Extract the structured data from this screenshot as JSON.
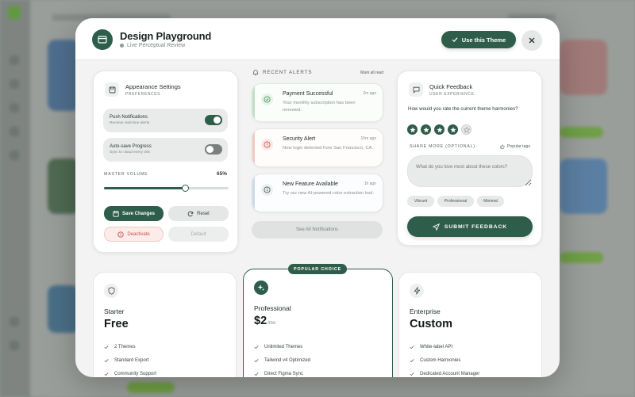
{
  "header": {
    "title": "Design Playground",
    "subtitle": "Live Perceptual Review",
    "use_theme": "Use this Theme"
  },
  "appearance": {
    "title": "Appearance Settings",
    "tag": "PREFERENCES",
    "push": {
      "title": "Push Notifications",
      "sub": "Receive real-time alerts",
      "on": true
    },
    "autosave": {
      "title": "Auto-save Progress",
      "sub": "Sync to cloud every 30s",
      "on": false
    },
    "volume_label": "MASTER VOLUME",
    "volume_value": "65%",
    "volume": 0.65,
    "save": "Save Changes",
    "reset": "Reset",
    "deactivate": "Deactivate",
    "default": "Default"
  },
  "alerts": {
    "title": "RECENT ALERTS",
    "mark_all": "Mark all read",
    "items": [
      {
        "title": "Payment Successful",
        "time": "2m ago",
        "msg": "Your monthly subscription has been renewed.",
        "color": "#4f9a5e"
      },
      {
        "title": "Security Alert",
        "time": "15m ago",
        "msg": "New login detected from San Francisco, CA.",
        "color": "#d9534f"
      },
      {
        "title": "New Feature Available",
        "time": "1h ago",
        "msg": "Try our new AI-powered color extraction tool.",
        "color": "#5b7fa8"
      }
    ],
    "see_all": "See All Notifications"
  },
  "feedback": {
    "title": "Quick Feedback",
    "tag": "USER EXPERIENCE",
    "question": "How would you rate the current theme harmonies?",
    "rating": 4,
    "max_rating": 5,
    "share_label": "SHARE MORE (OPTIONAL)",
    "popular_tags": "Popular tags",
    "placeholder": "What do you love most about these colors?",
    "chips": [
      "Vibrant",
      "Professional",
      "Minimal"
    ],
    "submit": "SUBMIT FEEDBACK"
  },
  "pricing": {
    "popular_badge": "POPULAR CHOICE",
    "plans": [
      {
        "name": "Starter",
        "price": "Free",
        "per": "",
        "features": [
          "2 Themes",
          "Standard Export",
          "Community Support"
        ]
      },
      {
        "name": "Professional",
        "price": "$2",
        "per": "/mo",
        "features": [
          "Unlimited Themes",
          "Tailwind v4 Optimized",
          "Direct Figma Sync"
        ]
      },
      {
        "name": "Enterprise",
        "price": "Custom",
        "per": "",
        "features": [
          "White-label API",
          "Custom Harmonies",
          "Dedicated Account Manager"
        ]
      }
    ]
  },
  "colors": {
    "primary": "#2f5d4b",
    "danger": "#c8504a"
  }
}
